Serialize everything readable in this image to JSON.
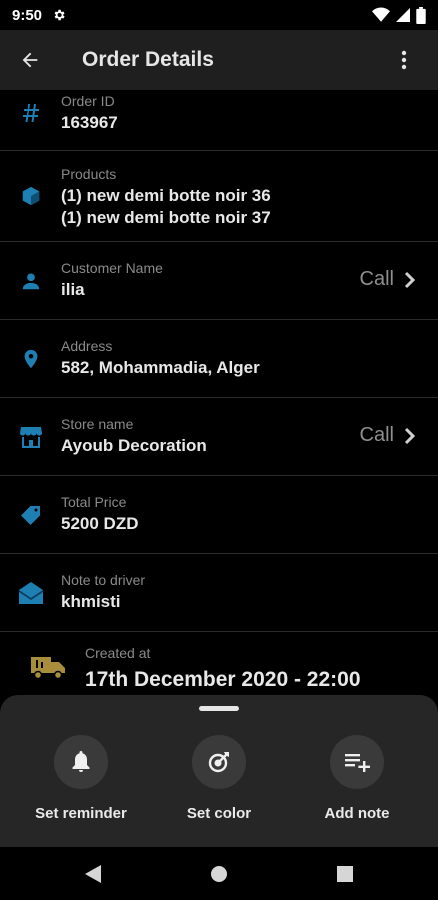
{
  "status_bar": {
    "time": "9:50"
  },
  "app_bar": {
    "title": "Order Details"
  },
  "rows": [
    {
      "label": "Order ID",
      "value": "163967",
      "icon": "hash-icon"
    },
    {
      "label": "Products",
      "value": "(1) new demi botte noir 36",
      "value2": "(1) new demi botte noir 37",
      "icon": "box-icon"
    },
    {
      "label": "Customer Name",
      "value": "ilia",
      "action": "Call",
      "icon": "person-icon"
    },
    {
      "label": "Address",
      "value": "582, Mohammadia, Alger",
      "icon": "location-pin-icon"
    },
    {
      "label": "Store name",
      "value": "Ayoub Decoration",
      "action": "Call",
      "icon": "store-icon"
    },
    {
      "label": "Total Price",
      "value": "5200 DZD",
      "icon": "price-tag-icon"
    },
    {
      "label": "Note to driver",
      "value": "khmisti",
      "icon": "envelope-icon"
    },
    {
      "label": "Created at",
      "value": "17th December 2020 - 22:00",
      "icon": "delivery-truck-icon"
    }
  ],
  "sheet": {
    "actions": [
      {
        "label": "Set reminder",
        "icon": "bell-icon"
      },
      {
        "label": "Set color",
        "icon": "color-target-icon"
      },
      {
        "label": "Add note",
        "icon": "playlist-add-icon"
      }
    ]
  },
  "colors": {
    "accent": "#1e7fb3",
    "truck": "#a88d3c",
    "background": "#000000",
    "app_bar": "#1f1f1f",
    "sheet": "#262626"
  }
}
